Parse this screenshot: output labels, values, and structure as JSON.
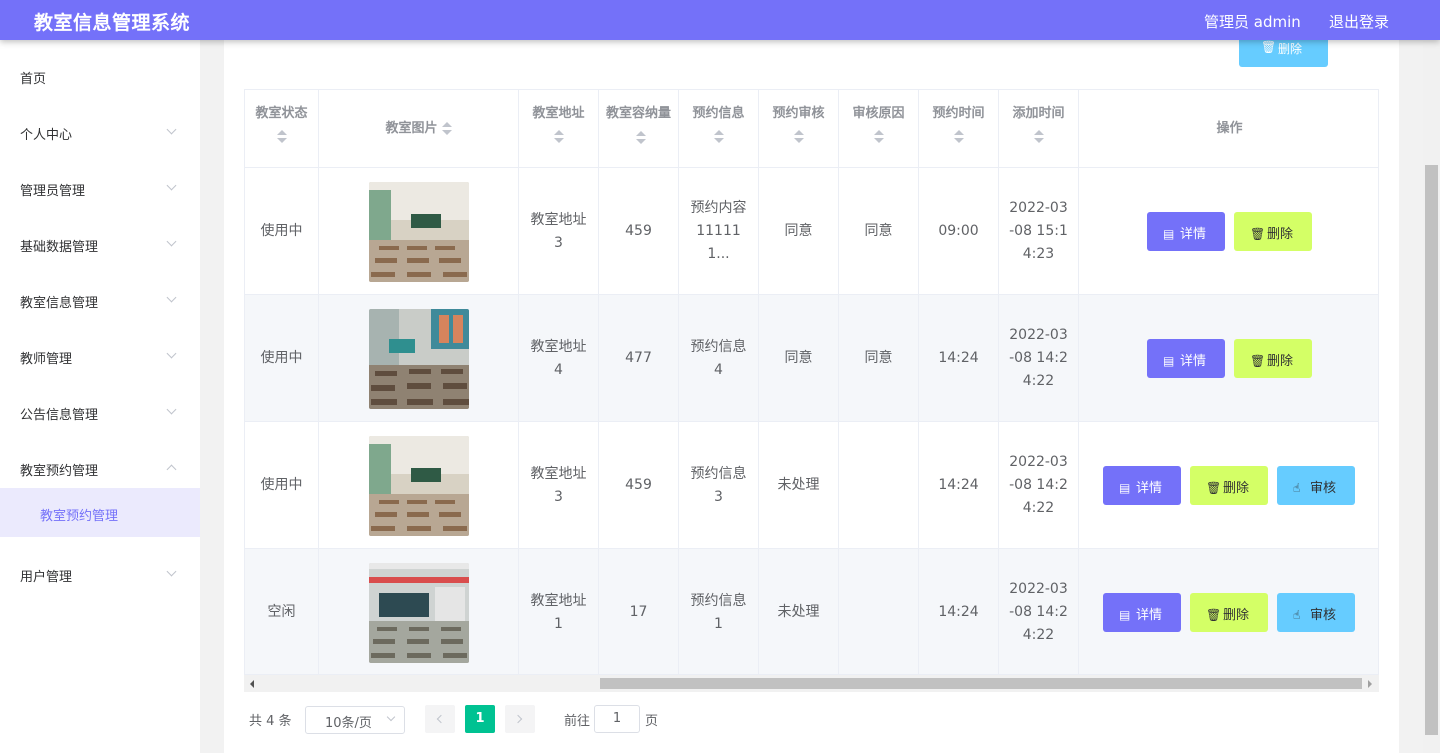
{
  "header": {
    "app_title": "教室信息管理系统",
    "user_label": "管理员 admin",
    "logout_label": "退出登录"
  },
  "sidebar": {
    "items": [
      {
        "label": "首页",
        "has_chevron": false
      },
      {
        "label": "个人中心",
        "has_chevron": true
      },
      {
        "label": "管理员管理",
        "has_chevron": true
      },
      {
        "label": "基础数据管理",
        "has_chevron": true
      },
      {
        "label": "教室信息管理",
        "has_chevron": true
      },
      {
        "label": "教师管理",
        "has_chevron": true
      },
      {
        "label": "公告信息管理",
        "has_chevron": true
      },
      {
        "label": "教室预约管理",
        "has_chevron": true,
        "expanded": true
      },
      {
        "label": "用户管理",
        "has_chevron": true
      }
    ],
    "active_subitem": "教室预约管理"
  },
  "toolbar": {
    "delete_label": "删除",
    "delete_icon": "trash-icon"
  },
  "table": {
    "headers": [
      "教室状态",
      "教室图片",
      "教室地址",
      "教室容纳量",
      "预约信息",
      "预约审核",
      "审核原因",
      "预约时间",
      "添加时间",
      "操作"
    ],
    "rows": [
      {
        "status": "使用中",
        "image": "classroom-photo-a",
        "address": "教室地址3",
        "capacity": "459",
        "booking_info": "预约内容111111...",
        "review": "同意",
        "reason": "同意",
        "booking_time": "09:00",
        "added_time": "2022-03-08 15:14:23",
        "actions": [
          "详情",
          "删除"
        ]
      },
      {
        "status": "使用中",
        "image": "classroom-photo-b",
        "address": "教室地址4",
        "capacity": "477",
        "booking_info": "预约信息4",
        "review": "同意",
        "reason": "同意",
        "booking_time": "14:24",
        "added_time": "2022-03-08 14:24:22",
        "actions": [
          "详情",
          "删除"
        ]
      },
      {
        "status": "使用中",
        "image": "classroom-photo-a",
        "address": "教室地址3",
        "capacity": "459",
        "booking_info": "预约信息3",
        "review": "未处理",
        "reason": "",
        "booking_time": "14:24",
        "added_time": "2022-03-08 14:24:22",
        "actions": [
          "详情",
          "删除",
          "审核"
        ]
      },
      {
        "status": "空闲",
        "image": "classroom-photo-c",
        "address": "教室地址1",
        "capacity": "17",
        "booking_info": "预约信息1",
        "review": "未处理",
        "reason": "",
        "booking_time": "14:24",
        "added_time": "2022-03-08 14:24:22",
        "actions": [
          "详情",
          "删除",
          "审核"
        ]
      }
    ],
    "action_labels": {
      "detail": "详情",
      "delete": "删除",
      "audit": "审核"
    }
  },
  "pagination": {
    "total_text": "共 4 条",
    "page_size": "10条/页",
    "current_page": "1",
    "goto_label": "前往",
    "goto_value": "1",
    "page_suffix": "页"
  },
  "colors": {
    "primary": "#7471f9",
    "detail_button": "#7471f9",
    "delete_button": "#d4ff66",
    "audit_button": "#66ccff",
    "top_delete_button": "#66ccff",
    "pager_active": "#00c292"
  }
}
